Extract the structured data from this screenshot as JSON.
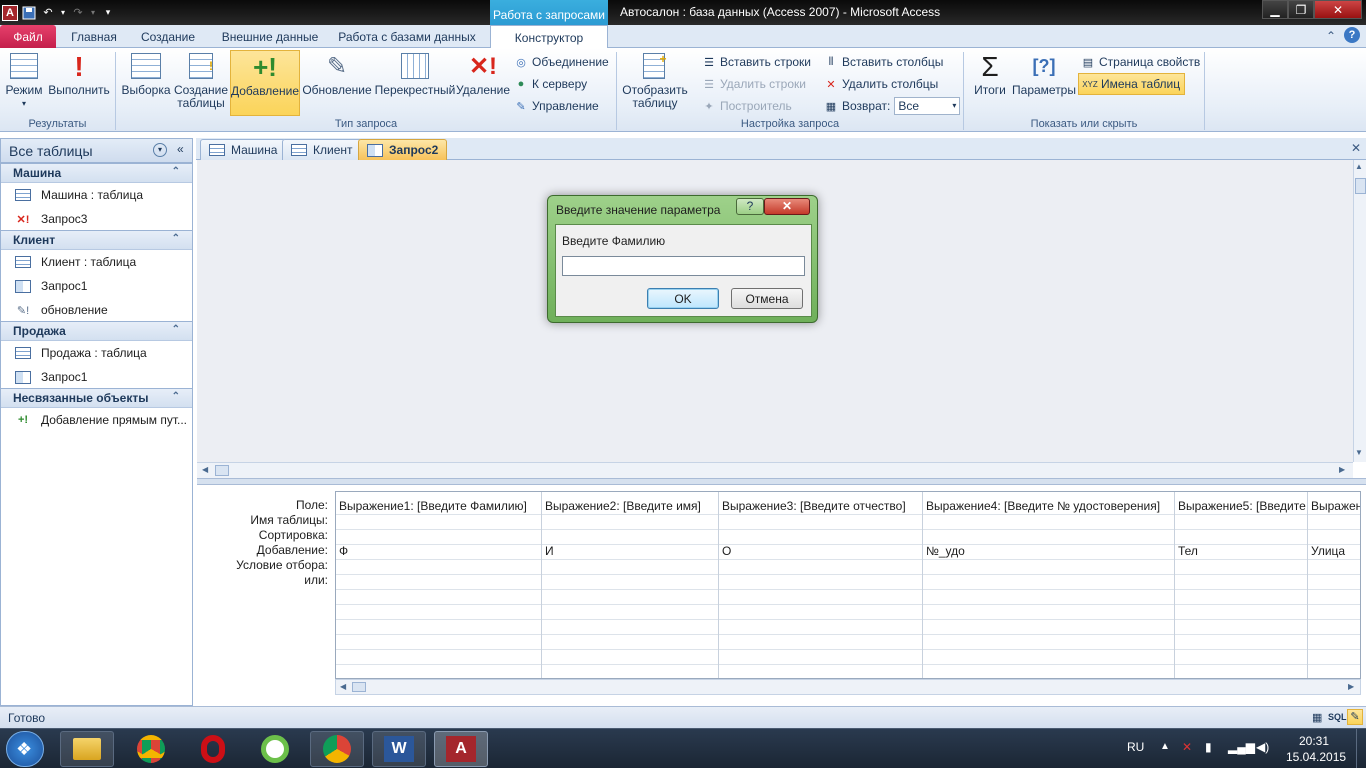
{
  "window": {
    "title": "Автосалон : база данных (Access 2007)  -  Microsoft Access",
    "context_group": "Работа с запросами"
  },
  "ribbon_tabs": [
    {
      "label": "Файл"
    },
    {
      "label": "Главная"
    },
    {
      "label": "Создание"
    },
    {
      "label": "Внешние данные"
    },
    {
      "label": "Работа с базами данных"
    },
    {
      "label": "Конструктор"
    }
  ],
  "ribbon": {
    "groups": {
      "results": "Результаты",
      "query_type": "Тип запроса",
      "query_setup": "Настройка запроса",
      "show_hide": "Показать или скрыть"
    },
    "buttons": {
      "mode": "Режим",
      "run": "Выполнить",
      "select": "Выборка",
      "make_table_1": "Создание",
      "make_table_2": "таблицы",
      "append": "Добавление",
      "update": "Обновление",
      "crosstab": "Перекрестный",
      "delete": "Удаление",
      "union": "Объединение",
      "to_server": "К серверу",
      "manage": "Управление",
      "show_table_1": "Отобразить",
      "show_table_2": "таблицу",
      "insert_rows": "Вставить строки",
      "delete_rows": "Удалить строки",
      "builder": "Построитель",
      "insert_cols": "Вставить столбцы",
      "delete_cols": "Удалить столбцы",
      "return_label": "Возврат:",
      "return_value": "Все",
      "totals": "Итоги",
      "params": "Параметры",
      "prop_sheet": "Страница свойств",
      "table_names": "Имена таблиц"
    }
  },
  "nav": {
    "header": "Все таблицы",
    "groups": [
      {
        "title": "Машина",
        "items": [
          "Машина : таблица",
          "Запрос3"
        ]
      },
      {
        "title": "Клиент",
        "items": [
          "Клиент : таблица",
          "Запрос1",
          "обновление"
        ]
      },
      {
        "title": "Продажа",
        "items": [
          "Продажа : таблица",
          "Запрос1"
        ]
      },
      {
        "title": "Несвязанные объекты",
        "items": [
          "Добавление прямым пут..."
        ]
      }
    ]
  },
  "doc_tabs": [
    "Машина",
    "Клиент",
    "Запрос2"
  ],
  "grid": {
    "row_labels": [
      "Поле:",
      "Имя таблицы:",
      "Сортировка:",
      "Добавление:",
      "Условие отбора:",
      "или:"
    ],
    "columns": [
      {
        "field": "Выражение1: [Введите Фамилию]",
        "append": "Ф"
      },
      {
        "field": "Выражение2: [Введите имя]",
        "append": "И"
      },
      {
        "field": "Выражение3: [Введите отчество]",
        "append": "О"
      },
      {
        "field": "Выражение4: [Введите № удостоверения]",
        "append": "№_удо"
      },
      {
        "field": "Выражение5: [Введите т",
        "append": "Тел"
      },
      {
        "field": "Выражен",
        "append": "Улица"
      }
    ]
  },
  "dialog": {
    "title": "Введите значение параметра",
    "prompt": "Введите Фамилию",
    "input_value": "",
    "ok": "OK",
    "cancel": "Отмена",
    "help": "?"
  },
  "status": {
    "text": "Готово",
    "sql": "SQL"
  },
  "taskbar": {
    "lang": "RU",
    "time": "20:31",
    "date": "15.04.2015"
  }
}
